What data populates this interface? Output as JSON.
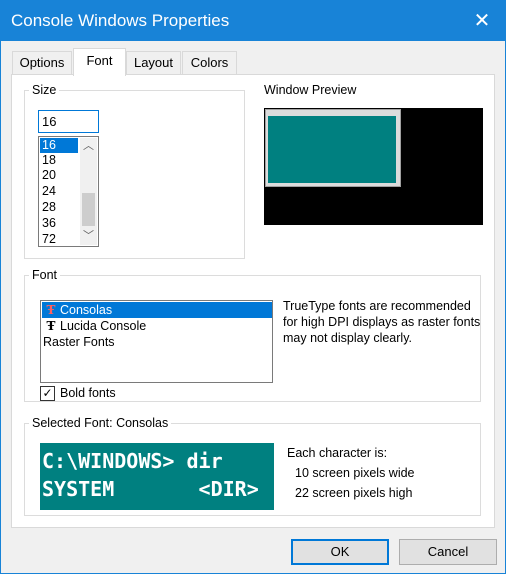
{
  "window": {
    "title": "Console Windows Properties",
    "close_glyph": "✕"
  },
  "tabs": [
    {
      "label": "Options"
    },
    {
      "label": "Font"
    },
    {
      "label": "Layout"
    },
    {
      "label": "Colors"
    }
  ],
  "size": {
    "label": "Size",
    "value": "16",
    "options": [
      "16",
      "18",
      "20",
      "24",
      "28",
      "36",
      "72"
    ],
    "selected": "16"
  },
  "preview": {
    "label": "Window Preview"
  },
  "font": {
    "label": "Font",
    "items": [
      {
        "label": "Consolas",
        "icon": "truetype-font-icon"
      },
      {
        "label": "Lucida Console",
        "icon": "truetype-font-icon"
      },
      {
        "label": "Raster Fonts",
        "icon": ""
      }
    ],
    "selected": "Consolas",
    "note": "TrueType fonts are recommended for high DPI displays as raster fonts may not display clearly.",
    "bold_label": "Bold fonts",
    "bold_checked": true
  },
  "selected_font": {
    "label": "Selected Font: Consolas",
    "sample_line1": "C:\\WINDOWS> dir",
    "sample_line2": "SYSTEM       <DIR>",
    "char_heading": "Each character is:",
    "width_text": "10 screen pixels wide",
    "height_text": "22 screen pixels high"
  },
  "buttons": {
    "ok": "OK",
    "cancel": "Cancel"
  },
  "colors": {
    "accent": "#0078d7",
    "titlebar": "#1883d7",
    "console_bg": "#008080"
  }
}
